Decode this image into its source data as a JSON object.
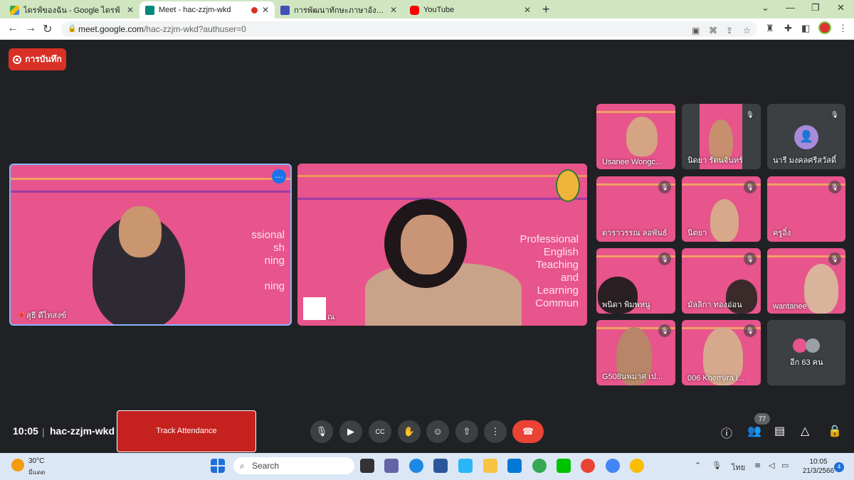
{
  "browser": {
    "tabs": [
      {
        "label": "ไดรฟ์ของฉัน - Google ไดรฟ์",
        "icon": "google-drive-icon",
        "color": "#fbbc04"
      },
      {
        "label": "Meet - hac-zzjm-wkd",
        "icon": "google-meet-icon",
        "color": "#00897b"
      },
      {
        "label": "การพัฒนาทักษะภาษาอังกฤษ English",
        "icon": "google-forms-icon",
        "color": "#3f51b5"
      },
      {
        "label": "YouTube",
        "icon": "youtube-icon",
        "color": "#ff0000"
      }
    ],
    "url_host": "meet.google.com",
    "url_path": "/hac-zzjm-wkd?authuser=0"
  },
  "meet": {
    "recording_label": "การบันทึก",
    "main_tiles": [
      {
        "name": "สุธี ดีไทสงข์"
      },
      {
        "name": "ณ"
      }
    ],
    "slide_text": [
      "Professional",
      "English",
      "Teaching",
      "and",
      "Learning",
      "Commun"
    ],
    "participants": [
      {
        "name": "Usanee Wongc..."
      },
      {
        "name": "นิดยา รัตนจันทร์"
      },
      {
        "name": "นารี มงคลศรีสวัสดิ์"
      },
      {
        "name": "ดาราวรรณ ลอพันธ์"
      },
      {
        "name": "นิตยา"
      },
      {
        "name": "ครูอิ๋ง"
      },
      {
        "name": "พนิดา พิมพหนู"
      },
      {
        "name": "มัลลิกา ทองอ่อน"
      },
      {
        "name": "wantanee"
      },
      {
        "name": "G508นพมาศ เป..."
      },
      {
        "name": "006 Khemjira I..."
      }
    ],
    "others_label": "อีก 63 คน",
    "time": "10:05",
    "meeting_code": "hac-zzjm-wkd",
    "track_label": "Track Attendance",
    "people_count": "77",
    "colors": {
      "tile_pink": "#e8548c",
      "end_call": "#ea4335",
      "record": "#d93025",
      "speaker_border": "#8ab4f8"
    }
  },
  "taskbar": {
    "temp": "30°C",
    "condition": "มีแดด",
    "search": "Search",
    "lang": "ไทย",
    "clock_time": "10:05",
    "clock_date": "21/3/2566",
    "notifications": "4"
  }
}
